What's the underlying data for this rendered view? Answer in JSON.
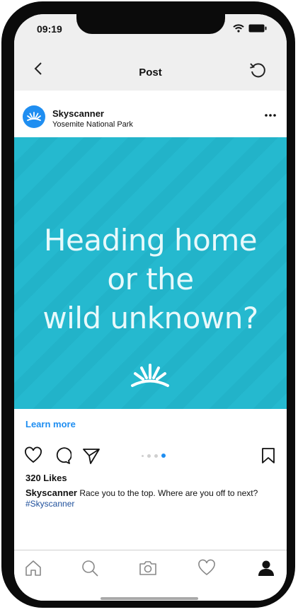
{
  "status_bar": {
    "time": "09:19"
  },
  "nav": {
    "title": "Post"
  },
  "post": {
    "account_name": "Skyscanner",
    "location": "Yosemite National Park",
    "media": {
      "headline_lines": [
        "Heading home",
        "or the",
        "wild unknown?"
      ],
      "background_color": "#25b9cf",
      "carousel_total": 4,
      "carousel_active_index": 3
    },
    "cta_label": "Learn more",
    "likes": "320 Likes",
    "caption_author": "Skyscanner",
    "caption_text": "Race you to the top. Where are you off to next?",
    "hashtag": "#Skyscanner"
  },
  "colors": {
    "accent": "#1f8ef1",
    "hashtag": "#1e4f9b"
  },
  "icons": {
    "nav": [
      "back-chevron-icon",
      "refresh-icon"
    ],
    "actions": [
      "heart-icon",
      "comment-icon",
      "send-icon",
      "bookmark-icon"
    ],
    "tabs": [
      "home-icon",
      "search-icon",
      "camera-icon",
      "heart-icon",
      "profile-icon"
    ]
  }
}
